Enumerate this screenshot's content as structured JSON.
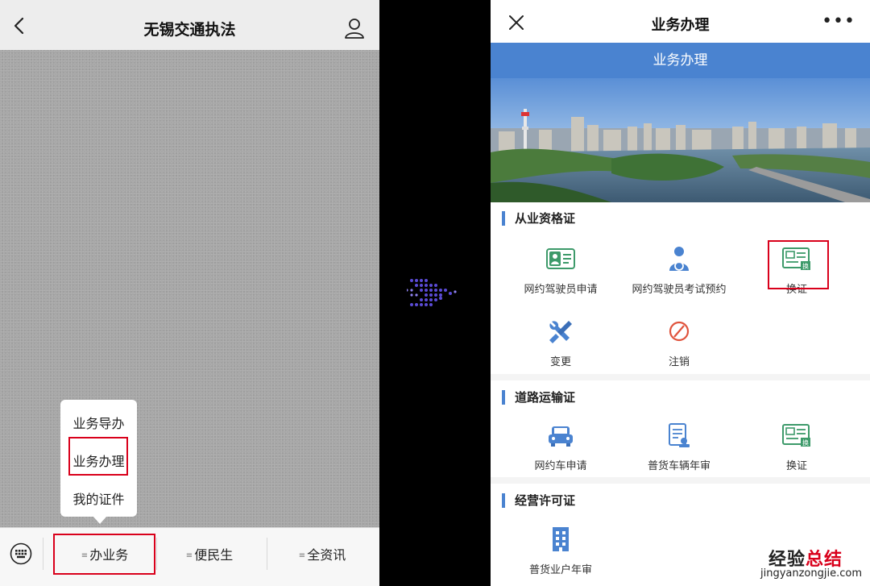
{
  "left_screen": {
    "title": "无锡交通执法",
    "popup_menu": [
      "业务导办",
      "业务办理",
      "我的证件"
    ],
    "tabs": [
      "办业务",
      "便民生",
      "全资讯"
    ]
  },
  "right_screen": {
    "title": "业务办理",
    "banner": "业务办理",
    "sections": [
      {
        "title": "从业资格证",
        "items": [
          "网约驾驶员申请",
          "网约驾驶员考试预约",
          "换证",
          "变更",
          "注销"
        ]
      },
      {
        "title": "道路运输证",
        "items": [
          "网约车申请",
          "普货车辆年审",
          "换证"
        ]
      },
      {
        "title": "经营许可证",
        "items": [
          "普货业户年审"
        ]
      }
    ],
    "watermark": {
      "brand_dark": "经验",
      "brand_red": "总结",
      "url": "jingyanzongjie.com"
    }
  },
  "colors": {
    "accent": "#4a83d0",
    "highlight_red": "#d9001b",
    "icon_green": "#3d9a6a"
  }
}
